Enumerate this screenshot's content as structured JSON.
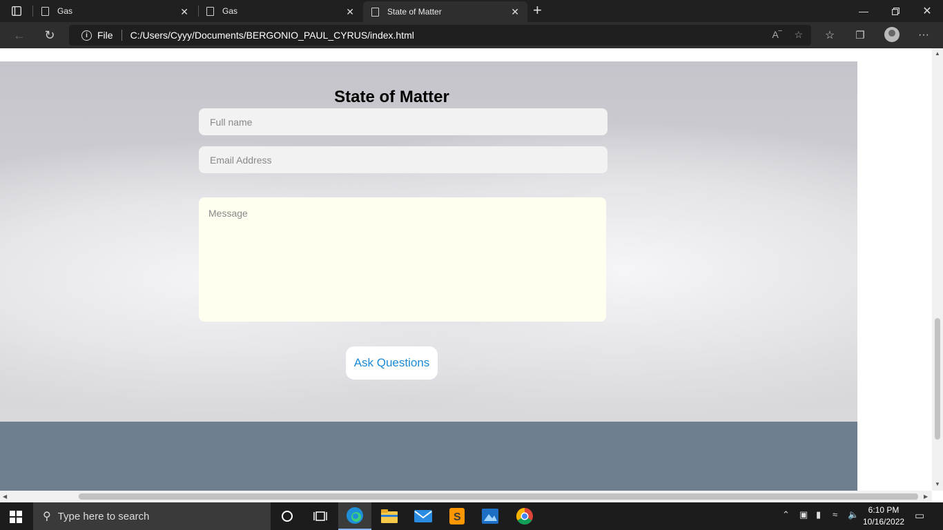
{
  "browser": {
    "tabs": [
      {
        "title": "Gas"
      },
      {
        "title": "Gas"
      },
      {
        "title": "State of Matter"
      }
    ],
    "address": {
      "scheme_label": "File",
      "url": "C:/Users/Cyyy/Documents/BERGONIO_PAUL_CYRUS/index.html"
    }
  },
  "page": {
    "title": "State of Matter",
    "form": {
      "full_name_placeholder": "Full name",
      "email_placeholder": "Email Address",
      "message_placeholder": "Message",
      "submit_label": "Ask Questions"
    },
    "footer_color": "#6f7f8f"
  },
  "taskbar": {
    "search_placeholder": "Type here to search",
    "time": "6:10 PM",
    "date": "10/16/2022"
  }
}
